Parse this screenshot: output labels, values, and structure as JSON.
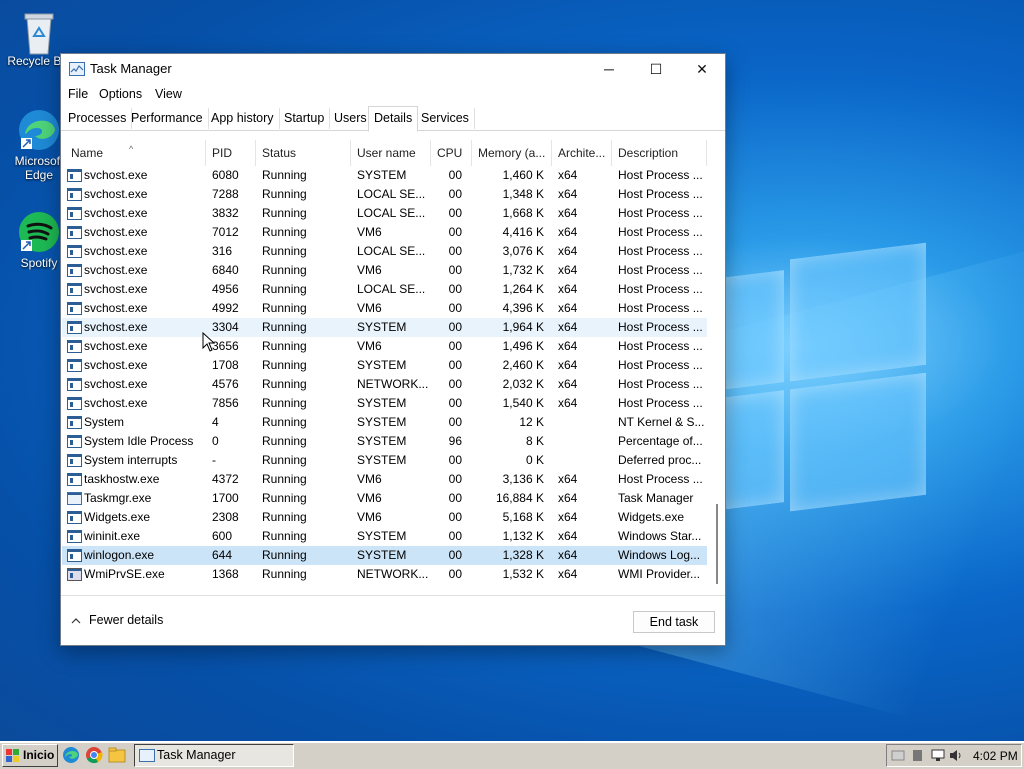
{
  "desktop": {
    "icons": [
      {
        "label": "Recycle Bin",
        "icon": "recycle-bin-icon"
      },
      {
        "label": "Microsoft Edge",
        "icon": "edge-icon"
      },
      {
        "label": "Spotify",
        "icon": "spotify-icon"
      }
    ]
  },
  "window": {
    "title": "Task Manager",
    "controls": {
      "minimize": "─",
      "maximize": "☐",
      "close": "✕"
    },
    "menu": [
      "File",
      "Options",
      "View"
    ],
    "tabs": [
      {
        "label": "Processes"
      },
      {
        "label": "Performance"
      },
      {
        "label": "App history"
      },
      {
        "label": "Startup"
      },
      {
        "label": "Users"
      },
      {
        "label": "Details",
        "active": true
      },
      {
        "label": "Services"
      }
    ],
    "columns": [
      "Name",
      "PID",
      "Status",
      "User name",
      "CPU",
      "Memory (a...",
      "Archite...",
      "Description"
    ],
    "rows": [
      {
        "name": "svchost.exe",
        "pid": "6080",
        "status": "Running",
        "user": "SYSTEM",
        "cpu": "00",
        "mem": "1,460 K",
        "arch": "x64",
        "desc": "Host Process ..."
      },
      {
        "name": "svchost.exe",
        "pid": "7288",
        "status": "Running",
        "user": "LOCAL SE...",
        "cpu": "00",
        "mem": "1,348 K",
        "arch": "x64",
        "desc": "Host Process ..."
      },
      {
        "name": "svchost.exe",
        "pid": "3832",
        "status": "Running",
        "user": "LOCAL SE...",
        "cpu": "00",
        "mem": "1,668 K",
        "arch": "x64",
        "desc": "Host Process ..."
      },
      {
        "name": "svchost.exe",
        "pid": "7012",
        "status": "Running",
        "user": "VM6",
        "cpu": "00",
        "mem": "4,416 K",
        "arch": "x64",
        "desc": "Host Process ..."
      },
      {
        "name": "svchost.exe",
        "pid": "316",
        "status": "Running",
        "user": "LOCAL SE...",
        "cpu": "00",
        "mem": "3,076 K",
        "arch": "x64",
        "desc": "Host Process ..."
      },
      {
        "name": "svchost.exe",
        "pid": "6840",
        "status": "Running",
        "user": "VM6",
        "cpu": "00",
        "mem": "1,732 K",
        "arch": "x64",
        "desc": "Host Process ..."
      },
      {
        "name": "svchost.exe",
        "pid": "4956",
        "status": "Running",
        "user": "LOCAL SE...",
        "cpu": "00",
        "mem": "1,264 K",
        "arch": "x64",
        "desc": "Host Process ..."
      },
      {
        "name": "svchost.exe",
        "pid": "4992",
        "status": "Running",
        "user": "VM6",
        "cpu": "00",
        "mem": "4,396 K",
        "arch": "x64",
        "desc": "Host Process ..."
      },
      {
        "name": "svchost.exe",
        "pid": "3304",
        "status": "Running",
        "user": "SYSTEM",
        "cpu": "00",
        "mem": "1,964 K",
        "arch": "x64",
        "desc": "Host Process ...",
        "state": "hover"
      },
      {
        "name": "svchost.exe",
        "pid": "3656",
        "status": "Running",
        "user": "VM6",
        "cpu": "00",
        "mem": "1,496 K",
        "arch": "x64",
        "desc": "Host Process ..."
      },
      {
        "name": "svchost.exe",
        "pid": "1708",
        "status": "Running",
        "user": "SYSTEM",
        "cpu": "00",
        "mem": "2,460 K",
        "arch": "x64",
        "desc": "Host Process ..."
      },
      {
        "name": "svchost.exe",
        "pid": "4576",
        "status": "Running",
        "user": "NETWORK...",
        "cpu": "00",
        "mem": "2,032 K",
        "arch": "x64",
        "desc": "Host Process ..."
      },
      {
        "name": "svchost.exe",
        "pid": "7856",
        "status": "Running",
        "user": "SYSTEM",
        "cpu": "00",
        "mem": "1,540 K",
        "arch": "x64",
        "desc": "Host Process ..."
      },
      {
        "name": "System",
        "pid": "4",
        "status": "Running",
        "user": "SYSTEM",
        "cpu": "00",
        "mem": "12 K",
        "arch": "",
        "desc": "NT Kernel & S..."
      },
      {
        "name": "System Idle Process",
        "pid": "0",
        "status": "Running",
        "user": "SYSTEM",
        "cpu": "96",
        "mem": "8 K",
        "arch": "",
        "desc": "Percentage of..."
      },
      {
        "name": "System interrupts",
        "pid": "-",
        "status": "Running",
        "user": "SYSTEM",
        "cpu": "00",
        "mem": "0 K",
        "arch": "",
        "desc": "Deferred proc..."
      },
      {
        "name": "taskhostw.exe",
        "pid": "4372",
        "status": "Running",
        "user": "VM6",
        "cpu": "00",
        "mem": "3,136 K",
        "arch": "x64",
        "desc": "Host Process ..."
      },
      {
        "name": "Taskmgr.exe",
        "pid": "1700",
        "status": "Running",
        "user": "VM6",
        "cpu": "00",
        "mem": "16,884 K",
        "arch": "x64",
        "desc": "Task Manager",
        "icon": "tm"
      },
      {
        "name": "Widgets.exe",
        "pid": "2308",
        "status": "Running",
        "user": "VM6",
        "cpu": "00",
        "mem": "5,168 K",
        "arch": "x64",
        "desc": "Widgets.exe"
      },
      {
        "name": "wininit.exe",
        "pid": "600",
        "status": "Running",
        "user": "SYSTEM",
        "cpu": "00",
        "mem": "1,132 K",
        "arch": "x64",
        "desc": "Windows Star..."
      },
      {
        "name": "winlogon.exe",
        "pid": "644",
        "status": "Running",
        "user": "SYSTEM",
        "cpu": "00",
        "mem": "1,328 K",
        "arch": "x64",
        "desc": "Windows Log...",
        "state": "selected"
      },
      {
        "name": "WmiPrvSE.exe",
        "pid": "1368",
        "status": "Running",
        "user": "NETWORK...",
        "cpu": "00",
        "mem": "1,532 K",
        "arch": "x64",
        "desc": "WMI Provider...",
        "icon": "wmi"
      }
    ],
    "footer": {
      "fewer_details": "Fewer details",
      "end_task": "End task"
    }
  },
  "taskbar": {
    "start_label": "Inicio",
    "task_label": "Task Manager",
    "clock": "4:02 PM"
  },
  "colors": {
    "selection": "#cce4f7",
    "hover": "#e8f3fc",
    "desktop_blue": "#0a66c8",
    "taskbar": "#d4d0c8"
  }
}
